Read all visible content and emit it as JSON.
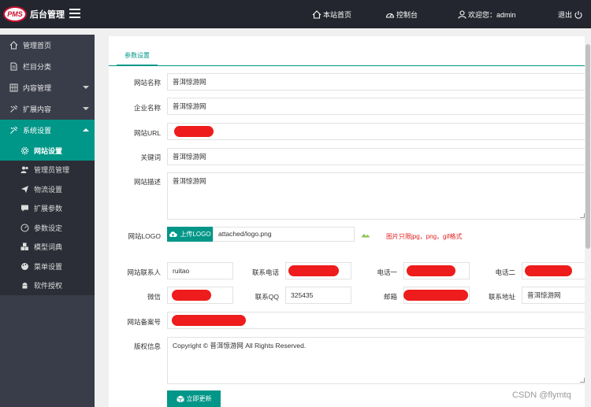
{
  "header": {
    "logo_badge": "PMS",
    "title": "后台管理",
    "links": {
      "home": "本站首页",
      "dashboard": "控制台",
      "welcome": "欢迎您：admin",
      "logout": "退出"
    }
  },
  "sidebar": {
    "items": [
      {
        "label": "管理首页",
        "icon": "home-icon"
      },
      {
        "label": "栏目分类",
        "icon": "document-icon"
      },
      {
        "label": "内容管理",
        "icon": "grid-icon"
      },
      {
        "label": "扩展内容",
        "icon": "tools-icon"
      },
      {
        "label": "系统设置",
        "icon": "tools-icon"
      }
    ],
    "sub_items": [
      {
        "label": "网站设置",
        "icon": "gear-icon"
      },
      {
        "label": "管理员管理",
        "icon": "users-icon"
      },
      {
        "label": "物流设置",
        "icon": "send-icon"
      },
      {
        "label": "扩展参数",
        "icon": "chat-icon"
      },
      {
        "label": "参数设定",
        "icon": "dashboard-icon"
      },
      {
        "label": "模型词典",
        "icon": "cubes-icon"
      },
      {
        "label": "菜单设置",
        "icon": "palette-icon"
      },
      {
        "label": "软件授权",
        "icon": "android-icon"
      }
    ]
  },
  "tab": {
    "label": "参数设置"
  },
  "form": {
    "site_name": {
      "label": "网站名称",
      "value": "普洱惊游网"
    },
    "company_name": {
      "label": "企业名称",
      "value": "普洱惊游网"
    },
    "site_url": {
      "label": "网站URL"
    },
    "keywords": {
      "label": "关键词",
      "value": "普洱惊游网"
    },
    "description": {
      "label": "网站描述",
      "value": "普洱惊游网"
    },
    "logo": {
      "label": "网站LOGO",
      "upload_label": "上传LOGO",
      "value": "attached/logo.png",
      "hint": "图片只限jpg，png，gif格式"
    },
    "contact": {
      "label": "网站联系人",
      "value": "ruitao"
    },
    "phone": {
      "label": "联系电话"
    },
    "phone1": {
      "label": "电话一"
    },
    "phone2": {
      "label": "电话二"
    },
    "wechat": {
      "label": "微信"
    },
    "qq": {
      "label": "联系QQ",
      "value": "325435"
    },
    "email": {
      "label": "邮箱"
    },
    "address": {
      "label": "联系地址",
      "value": "普洱惊游网"
    },
    "icp": {
      "label": "网站备案号"
    },
    "copyright": {
      "label": "版权信息",
      "value": "Copyright © 普洱惊游网 All Rights Reserved."
    },
    "submit_label": "立即更新"
  },
  "watermark": "CSDN @flymtq",
  "colors": {
    "accent": "#009688",
    "topbar": "#23262e",
    "sidebar": "#393d49"
  }
}
